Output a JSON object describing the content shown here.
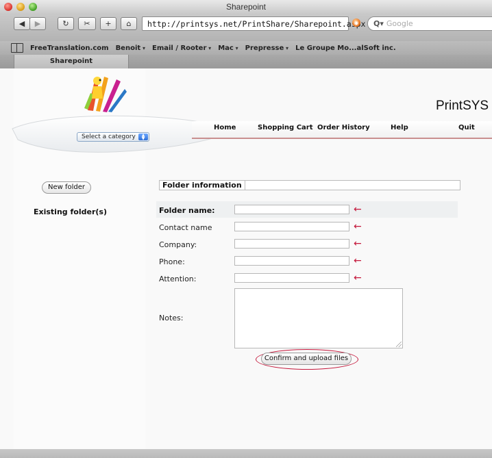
{
  "window": {
    "title": "Sharepoint"
  },
  "toolbar": {
    "url": "http://printsys.net/PrintShare/Sharepoint.aspx",
    "search_placeholder": "Google",
    "back_icon": "back-icon",
    "forward_icon": "forward-icon",
    "reload_icon": "reload-icon",
    "add_icon": "add-bookmark-icon",
    "home_icon": "home-icon"
  },
  "bookmarks": [
    {
      "label": "FreeTranslation.com",
      "menu": false
    },
    {
      "label": "Benoit",
      "menu": true
    },
    {
      "label": "Email / Rooter",
      "menu": true
    },
    {
      "label": "Mac",
      "menu": true
    },
    {
      "label": "Prepresse",
      "menu": true
    },
    {
      "label": "Le Groupe Mo...alSoft inc.",
      "menu": false
    }
  ],
  "tabs": [
    {
      "label": "Sharepoint",
      "active": true
    }
  ],
  "header": {
    "brand": "PrintSYS",
    "category_select": "Select a category",
    "nav": [
      "Home",
      "Shopping Cart",
      "Order History",
      "Help",
      "Quit"
    ]
  },
  "sidebar": {
    "new_folder": "New folder",
    "existing_folders": "Existing folder(s)"
  },
  "form": {
    "section_title": "Folder information",
    "fields": [
      {
        "label": "Folder name:",
        "bold": true,
        "value": ""
      },
      {
        "label": "Contact name",
        "bold": false,
        "value": ""
      },
      {
        "label": "Company:",
        "bold": false,
        "value": ""
      },
      {
        "label": "Phone:",
        "bold": false,
        "value": ""
      },
      {
        "label": "Attention:",
        "bold": false,
        "value": ""
      }
    ],
    "notes_label": "Notes:",
    "notes_value": "",
    "submit": "Confirm and upload files"
  },
  "colors": {
    "annotation_red": "#c4163a",
    "nav_rule": "#c98f8f"
  }
}
